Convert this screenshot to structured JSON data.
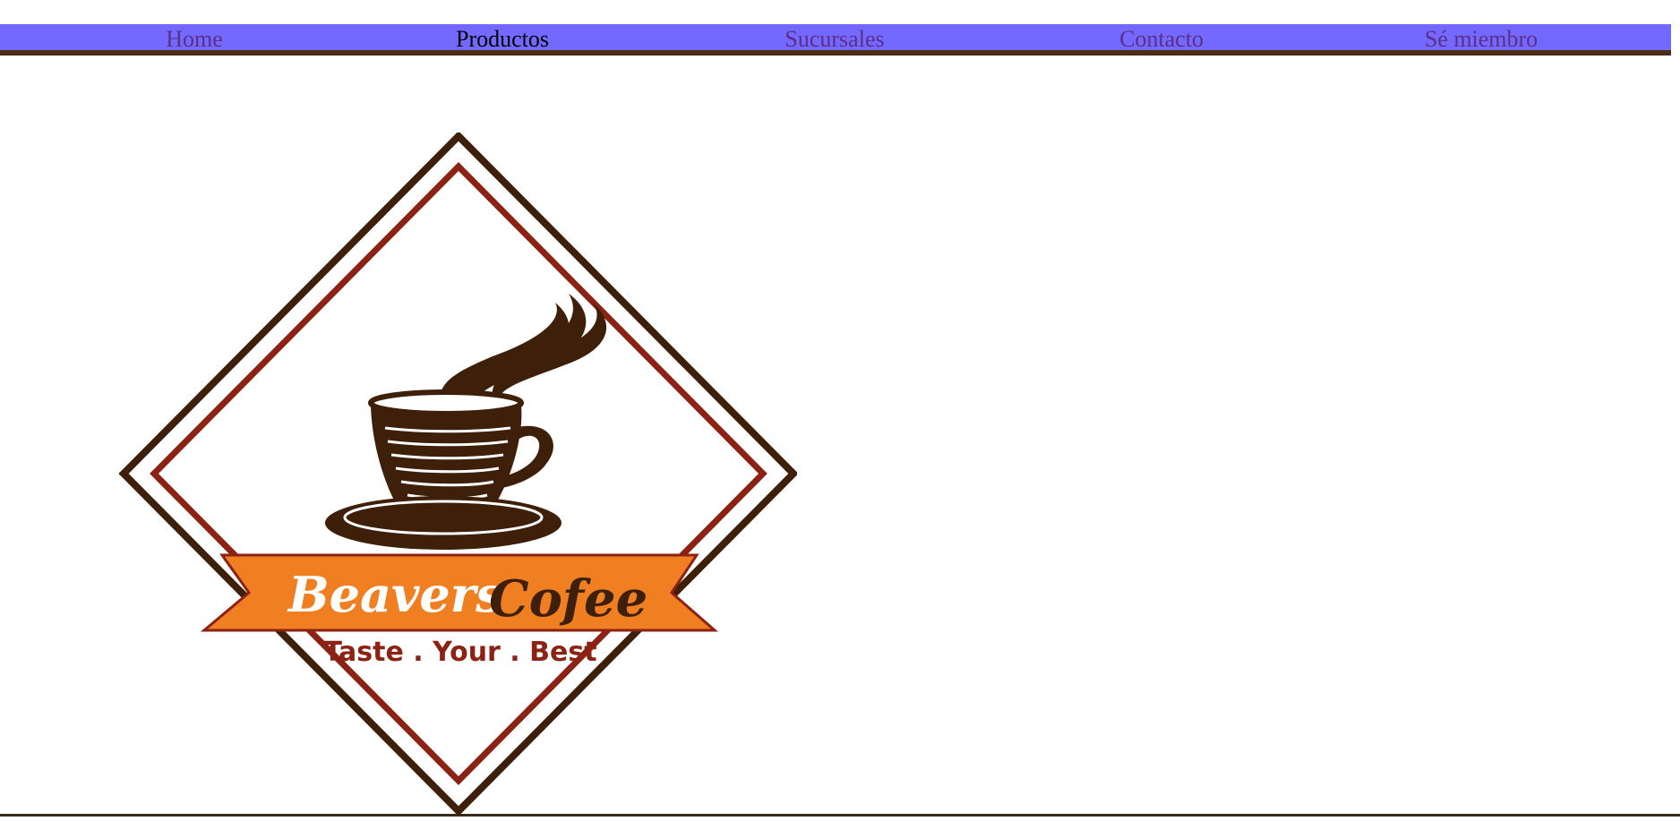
{
  "nav": {
    "items": [
      {
        "label": "Home",
        "active": false
      },
      {
        "label": "Productos",
        "active": true
      },
      {
        "label": "Sucursales",
        "active": false
      },
      {
        "label": "Contacto",
        "active": false
      },
      {
        "label": "Sé miembro",
        "active": false
      }
    ]
  },
  "logo": {
    "brand_word_1": "Beavers",
    "brand_word_2": "Cofee",
    "tagline": "Taste . Your . Best"
  },
  "colors": {
    "nav_bg": "#7469ff",
    "nav_border": "#4a2d12",
    "nav_link": "#5b2e87",
    "nav_active": "#000000",
    "logo_dark": "#3d1f0a",
    "logo_red": "#8b2213",
    "ribbon": "#f07f22"
  }
}
